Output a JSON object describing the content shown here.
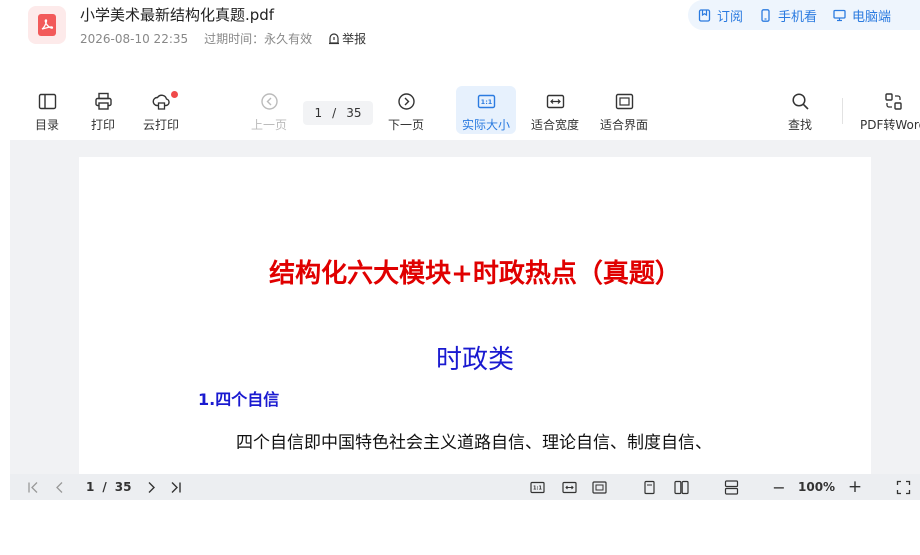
{
  "file": {
    "title": "小学美术最新结构化真题.pdf",
    "date": "2026-08-10 22:35",
    "expiry_label": "过期时间：",
    "expiry_value": "永久有效",
    "report_label": "举报"
  },
  "header_actions": {
    "subscribe": "订阅",
    "mobile": "手机看",
    "desktop": "电脑端"
  },
  "toolbar": {
    "toc": "目录",
    "print": "打印",
    "cloud_print": "云打印",
    "prev_page": "上一页",
    "current_page": "1",
    "separator": "/",
    "total_pages": "35",
    "next_page": "下一页",
    "actual_size": "实际大小",
    "fit_width": "适合宽度",
    "fit_page": "适合界面",
    "find": "查找",
    "pdf_to_word": "PDF转Word"
  },
  "document": {
    "heading": "结构化六大模块+时政热点（真题）",
    "subheading": "时政类",
    "section_title": "1.四个自信",
    "body_line_1": "四个自信即中国特色社会主义道路自信、理论自信、制度自信、"
  },
  "bottom_bar": {
    "current_page": "1",
    "separator": "/",
    "total_pages": "35",
    "zoom_minus": "−",
    "zoom": "100%",
    "zoom_plus": "+"
  },
  "colors": {
    "accent": "#2b7be0",
    "heading_red": "#e00000",
    "heading_blue": "#1a1ad0",
    "notify_dot": "#f04a4a"
  }
}
